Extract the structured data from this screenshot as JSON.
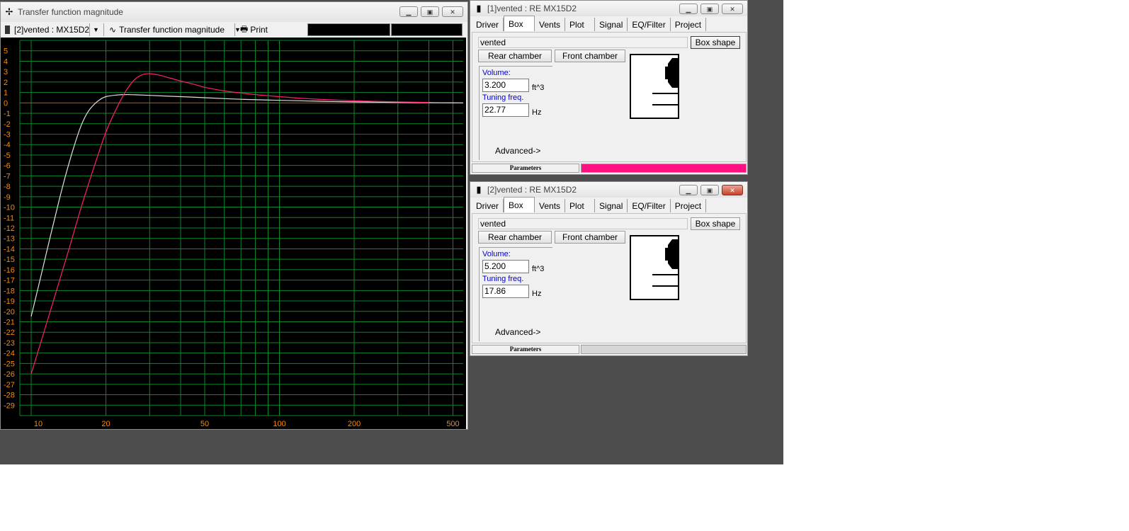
{
  "graph_window": {
    "title": "Transfer function magnitude",
    "toolbar": {
      "project_select": "[2]vented : MX15D2",
      "graph_select": "Transfer function magnitude",
      "print_label": "Print"
    }
  },
  "window1": {
    "title": "[1]vented : RE MX15D2",
    "tabs": [
      "Driver",
      "Box",
      "Vents",
      "Plot",
      "Signal",
      "EQ/Filter",
      "Project"
    ],
    "active_tab": "Box",
    "box_type": "vented",
    "box_shape_label": "Box shape",
    "rear_chamber_label": "Rear chamber",
    "front_chamber_label": "Front chamber",
    "volume_label": "Volume:",
    "volume_value": "3.200",
    "volume_unit": "ft^3",
    "tuning_label": "Tuning freq.",
    "tuning_value": "22.77",
    "tuning_unit": "Hz",
    "advanced_label": "Advanced->",
    "status_label": "Parameters",
    "status_color": "#ff0f80"
  },
  "window2": {
    "title": "[2]vented : RE MX15D2",
    "tabs": [
      "Driver",
      "Box",
      "Vents",
      "Plot",
      "Signal",
      "EQ/Filter",
      "Project"
    ],
    "active_tab": "Box",
    "box_type": "vented",
    "box_shape_label": "Box shape",
    "rear_chamber_label": "Rear chamber",
    "front_chamber_label": "Front chamber",
    "volume_label": "Volume:",
    "volume_value": "5.200",
    "volume_unit": "ft^3",
    "tuning_label": "Tuning freq.",
    "tuning_value": "17.86",
    "tuning_unit": "Hz",
    "advanced_label": "Advanced->",
    "status_label": "Parameters",
    "status_color": "#d6d6d6"
  },
  "chart_data": {
    "type": "line",
    "title": "",
    "xlabel": "",
    "ylabel": "",
    "x_scale": "log",
    "xlim": [
      9,
      550
    ],
    "ylim": [
      -30,
      6
    ],
    "x_ticks": [
      10,
      20,
      50,
      100,
      200,
      500
    ],
    "y_ticks": [
      5,
      4,
      3,
      2,
      1,
      0,
      -1,
      -2,
      -3,
      -4,
      -5,
      -6,
      -7,
      -8,
      -9,
      -10,
      -11,
      -12,
      -13,
      -14,
      -15,
      -16,
      -17,
      -18,
      -19,
      -20,
      -21,
      -22,
      -23,
      -24,
      -25,
      -26,
      -27,
      -28,
      -29
    ],
    "grid": true,
    "reference_lines": [
      {
        "y": 0,
        "color": "#ff1a1a"
      },
      {
        "y": -3,
        "color": "#a01a8c"
      }
    ],
    "series": [
      {
        "color": "#e0e0e0",
        "x": [
          10,
          11,
          12,
          13,
          14,
          15,
          16,
          17,
          18,
          19,
          20,
          22,
          24,
          26,
          30,
          40,
          50,
          70,
          100,
          150,
          200,
          300,
          400,
          550
        ],
        "y": [
          -20.5,
          -16.4,
          -12.6,
          -9.2,
          -6.3,
          -3.9,
          -2.0,
          -0.8,
          -0.1,
          0.35,
          0.6,
          0.75,
          0.8,
          0.78,
          0.72,
          0.6,
          0.5,
          0.35,
          0.25,
          0.15,
          0.1,
          0.05,
          0.02,
          0.0
        ]
      },
      {
        "color": "#ff1f6e",
        "x": [
          10,
          12,
          14,
          16,
          18,
          20,
          22,
          24,
          26,
          28,
          30,
          33,
          36,
          40,
          45,
          50,
          60,
          70,
          80,
          100,
          130,
          160,
          200,
          300,
          400
        ],
        "y": [
          -26.0,
          -19.8,
          -14.5,
          -9.8,
          -6.0,
          -2.8,
          -0.6,
          1.1,
          2.2,
          2.7,
          2.8,
          2.65,
          2.4,
          2.1,
          1.8,
          1.5,
          1.15,
          0.95,
          0.8,
          0.6,
          0.4,
          0.3,
          0.2,
          0.1,
          0.05
        ]
      }
    ]
  }
}
